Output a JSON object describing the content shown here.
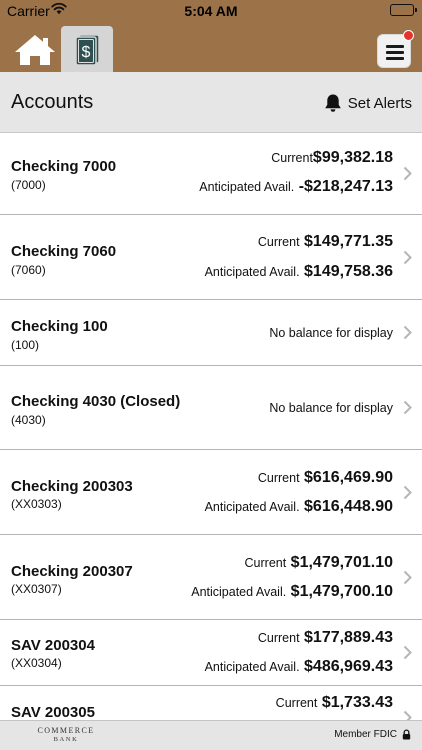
{
  "status_bar": {
    "carrier": "Carrier",
    "time": "5:04 AM"
  },
  "nav": {
    "active_tab": "statements",
    "menu_has_notification": true
  },
  "header": {
    "title": "Accounts",
    "set_alerts_label": "Set Alerts"
  },
  "accounts": [
    {
      "name": "Checking 7000",
      "number": "(7000)",
      "current_label": "Current",
      "current": "$99,382.18",
      "anticipated_label": "Anticipated Avail.",
      "anticipated": "-$218,247.13"
    },
    {
      "name": "Checking 7060",
      "number": "(7060)",
      "current_label": "Current",
      "current": "$149,771.35",
      "anticipated_label": "Anticipated Avail.",
      "anticipated": "$149,758.36"
    },
    {
      "name": "Checking 100",
      "number": "(100)",
      "no_balance": "No balance for display"
    },
    {
      "name": "Checking 4030 (Closed)",
      "number": "(4030)",
      "no_balance": "No balance for display"
    },
    {
      "name": "Checking 200303",
      "number": "(XX0303)",
      "current_label": "Current",
      "current": "$616,469.90",
      "anticipated_label": "Anticipated Avail.",
      "anticipated": "$616,448.90"
    },
    {
      "name": "Checking 200307",
      "number": "(XX0307)",
      "current_label": "Current",
      "current": "$1,479,701.10",
      "anticipated_label": "Anticipated Avail.",
      "anticipated": "$1,479,700.10"
    },
    {
      "name": "SAV 200304",
      "number": "(XX0304)",
      "current_label": "Current",
      "current": "$177,889.43",
      "anticipated_label": "Anticipated Avail.",
      "anticipated": "$486,969.43"
    },
    {
      "name": "SAV 200305",
      "current_label": "Current",
      "current": "$1,733.43"
    }
  ],
  "footer": {
    "logo_line1": "COMMERCE",
    "logo_line2": "BANK",
    "fdic_label": "Member FDIC"
  },
  "colors": {
    "nav_brown": "#9c7249",
    "header_gray": "#e6e6e6",
    "badge_red": "#e3352b"
  }
}
